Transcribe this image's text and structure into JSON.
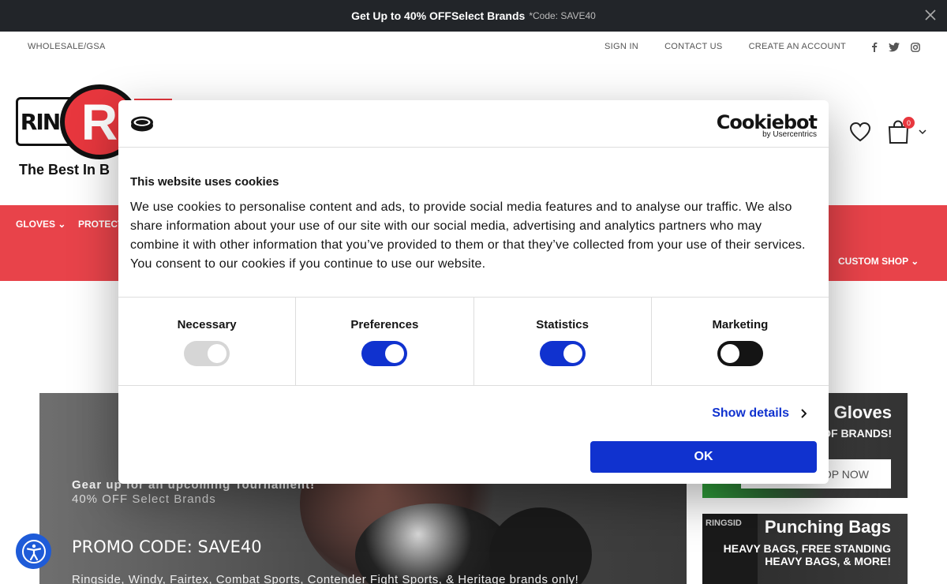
{
  "announcement": {
    "prefix": "Get Up to ",
    "highlight": "40% OFF",
    "suffix": " Select Brands",
    "code": "*Code: SAVE40"
  },
  "topnav": {
    "wholesale": "WHOLESALE/GSA",
    "links": [
      "SIGN IN",
      "CONTACT US",
      "CREATE AN ACCOUNT"
    ],
    "social": [
      "facebook-icon",
      "twitter-icon",
      "instagram-icon"
    ]
  },
  "header": {
    "logo_ring": "RING",
    "logo_r": "R",
    "tagline": "The Best In B",
    "cart_count": "0"
  },
  "rednav": {
    "items": [
      "GLOVES",
      "PROTECT"
    ],
    "custom": "CUSTOM SHOP"
  },
  "hero": {
    "line1": "Gear up for an upcoming Tournament!",
    "line2": "40% OFF Select Brands",
    "promo": "PROMO CODE: SAVE40",
    "brands": "Ringside, Windy, Fairtex, Combat Sports, Contender Fight Sports, & Heritage brands only!"
  },
  "side1": {
    "title": "Gloves",
    "sub": "OF BRANDS!",
    "button": "OP NOW"
  },
  "side2": {
    "bag_text": "RINGSID",
    "title": "Punching Bags",
    "sub": "HEAVY BAGS, FREE STANDING HEAVY BAGS, & MORE!"
  },
  "cookie": {
    "brand_name": "Cookiebot",
    "brand_sub": "by Usercentrics",
    "title": "This website uses cookies",
    "body": "We use cookies to personalise content and ads, to provide social media features and to analyse our traffic. We also share information about your use of our site with our social media, advertising and analytics partners who may combine it with other information that you’ve provided to them or that they’ve collected from your use of their services. You consent to our cookies if you continue to use our website.",
    "categories": [
      {
        "label": "Necessary",
        "state": "disabled"
      },
      {
        "label": "Preferences",
        "state": "on"
      },
      {
        "label": "Statistics",
        "state": "on"
      },
      {
        "label": "Marketing",
        "state": "off"
      }
    ],
    "show_details": "Show details",
    "ok": "OK"
  },
  "colors": {
    "brand_red": "#e8434a",
    "cookiebot_blue": "#1032cf",
    "announce_bg": "#222529"
  }
}
